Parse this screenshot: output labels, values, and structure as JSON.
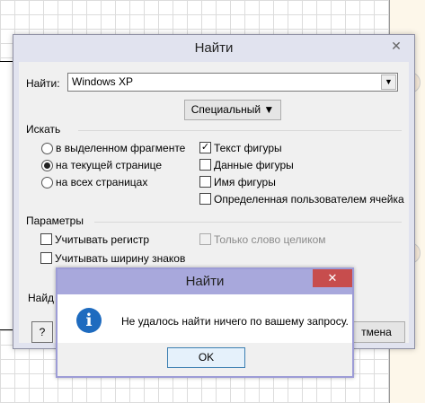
{
  "find_dialog": {
    "title": "Найти",
    "close_glyph": "✕",
    "find_label": "Найти:",
    "find_value": "Windows XP",
    "special_button": "Специальный ▼",
    "search_group": "Искать",
    "scope_options": [
      "в выделенном фрагменте",
      "на текущей странице",
      "на всех страницах"
    ],
    "scope_selected": 1,
    "search_in": [
      {
        "label": "Текст фигуры",
        "checked": true
      },
      {
        "label": "Данные фигуры",
        "checked": false
      },
      {
        "label": "Имя фигуры",
        "checked": false
      },
      {
        "label": "Определенная пользователем ячейка",
        "checked": false
      }
    ],
    "params_group": "Параметры",
    "match_case": "Учитывать регистр",
    "match_width": "Учитывать ширину знаков",
    "whole_word": "Только слово целиком",
    "find_next_partial": "Найд",
    "cancel_partial": "тмена",
    "help_icon": "help-icon"
  },
  "message_box": {
    "title": "Найти",
    "close_glyph": "✕",
    "icon": "info-icon",
    "icon_glyph": "i",
    "text": "Не удалось найти ничего по вашему запросу.",
    "ok_label": "OK"
  },
  "colors": {
    "message_title_bar": "#a8a8dc",
    "message_close": "#c74d4d",
    "info_icon": "#1e6bbf"
  }
}
